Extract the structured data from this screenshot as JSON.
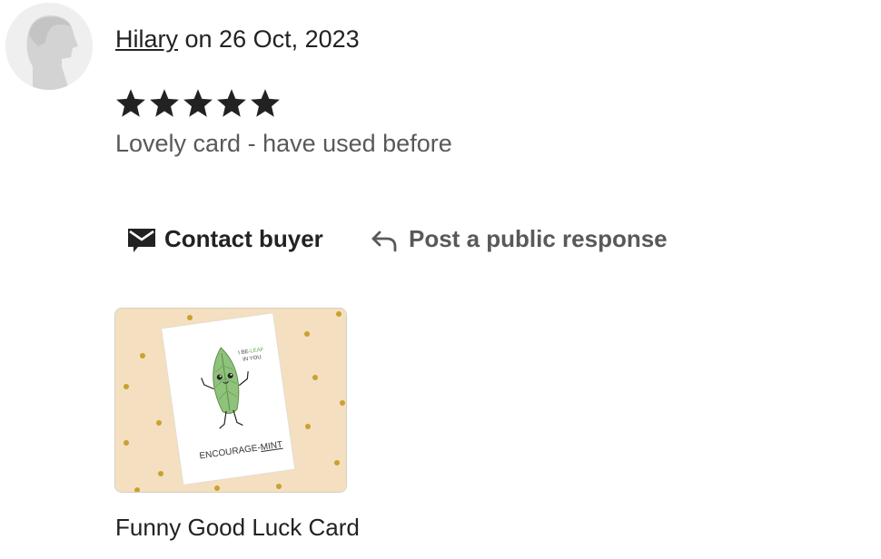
{
  "review": {
    "reviewer_name": "Hilary",
    "date_text": " on 26 Oct, 2023",
    "rating": 5,
    "rating_max": 5,
    "text": "Lovely card - have used before"
  },
  "actions": {
    "contact_label": "Contact buyer",
    "contact_icon": "envelope-icon",
    "respond_label": "Post a public response",
    "respond_icon": "reply-arrow-icon"
  },
  "product": {
    "title": "Funny Good Luck Card",
    "card_text_top_1": "I BE-",
    "card_text_leaf": "LEAF",
    "card_text_top_2": "IN YOU",
    "card_text_bottom_1": "ENCOURAGE-",
    "card_text_bottom_2": "MINT"
  },
  "colors": {
    "text_primary": "#222222",
    "text_secondary": "#595959",
    "star": "#222222",
    "thumb_bg": "#f4dfc0",
    "leaf": "#8fc27a"
  }
}
